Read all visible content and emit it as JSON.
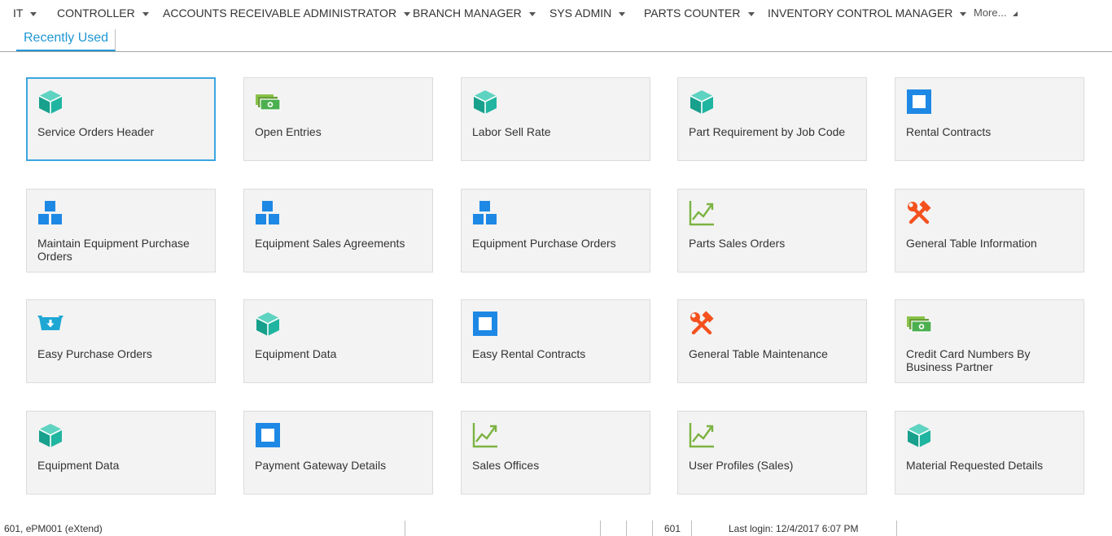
{
  "nav": {
    "items": [
      "IT",
      "CONTROLLER",
      "ACCOUNTS RECEIVABLE ADMINISTRATOR",
      "BRANCH MANAGER",
      "SYS ADMIN",
      "PARTS COUNTER",
      "INVENTORY CONTROL MANAGER"
    ],
    "more_label": "More..."
  },
  "tabs": {
    "recent_label": "Recently Used"
  },
  "tiles": [
    {
      "label": "Service Orders Header",
      "icon": "cube-icon"
    },
    {
      "label": "Open Entries",
      "icon": "money-icon"
    },
    {
      "label": "Labor Sell Rate",
      "icon": "cube-icon"
    },
    {
      "label": "Part Requirement by Job Code",
      "icon": "cube-icon"
    },
    {
      "label": "Rental Contracts",
      "icon": "blue-square-icon"
    },
    {
      "label": "Maintain Equipment Purchase Orders",
      "icon": "blocks-icon"
    },
    {
      "label": "Equipment Sales Agreements",
      "icon": "blocks-icon"
    },
    {
      "label": "Equipment Purchase Orders",
      "icon": "blocks-icon"
    },
    {
      "label": "Parts Sales Orders",
      "icon": "chart-up-icon"
    },
    {
      "label": "General Table Information",
      "icon": "tools-icon"
    },
    {
      "label": "Easy Purchase Orders",
      "icon": "inbox-down-icon"
    },
    {
      "label": "Equipment Data",
      "icon": "cube-icon"
    },
    {
      "label": "Easy Rental Contracts",
      "icon": "blue-square-icon"
    },
    {
      "label": "General Table Maintenance",
      "icon": "tools-icon"
    },
    {
      "label": "Credit Card Numbers By Business Partner",
      "icon": "money-icon"
    },
    {
      "label": "Equipment Data",
      "icon": "cube-icon"
    },
    {
      "label": "Payment Gateway Details",
      "icon": "blue-square-icon"
    },
    {
      "label": "Sales Offices",
      "icon": "chart-up-icon"
    },
    {
      "label": "User Profiles (Sales)",
      "icon": "chart-up-icon"
    },
    {
      "label": "Material Requested Details",
      "icon": "cube-icon"
    }
  ],
  "status": {
    "session": "601, ePM001 (eXtend)",
    "company": "601",
    "last_login": "Last login: 12/4/2017 6:07 PM"
  },
  "colors": {
    "accent": "#1f97d4",
    "teal": "#1fb5a0",
    "blue": "#1e88e5",
    "green": "#4caf50",
    "orange": "#f4511e",
    "tile_bg": "#f3f3f3"
  }
}
